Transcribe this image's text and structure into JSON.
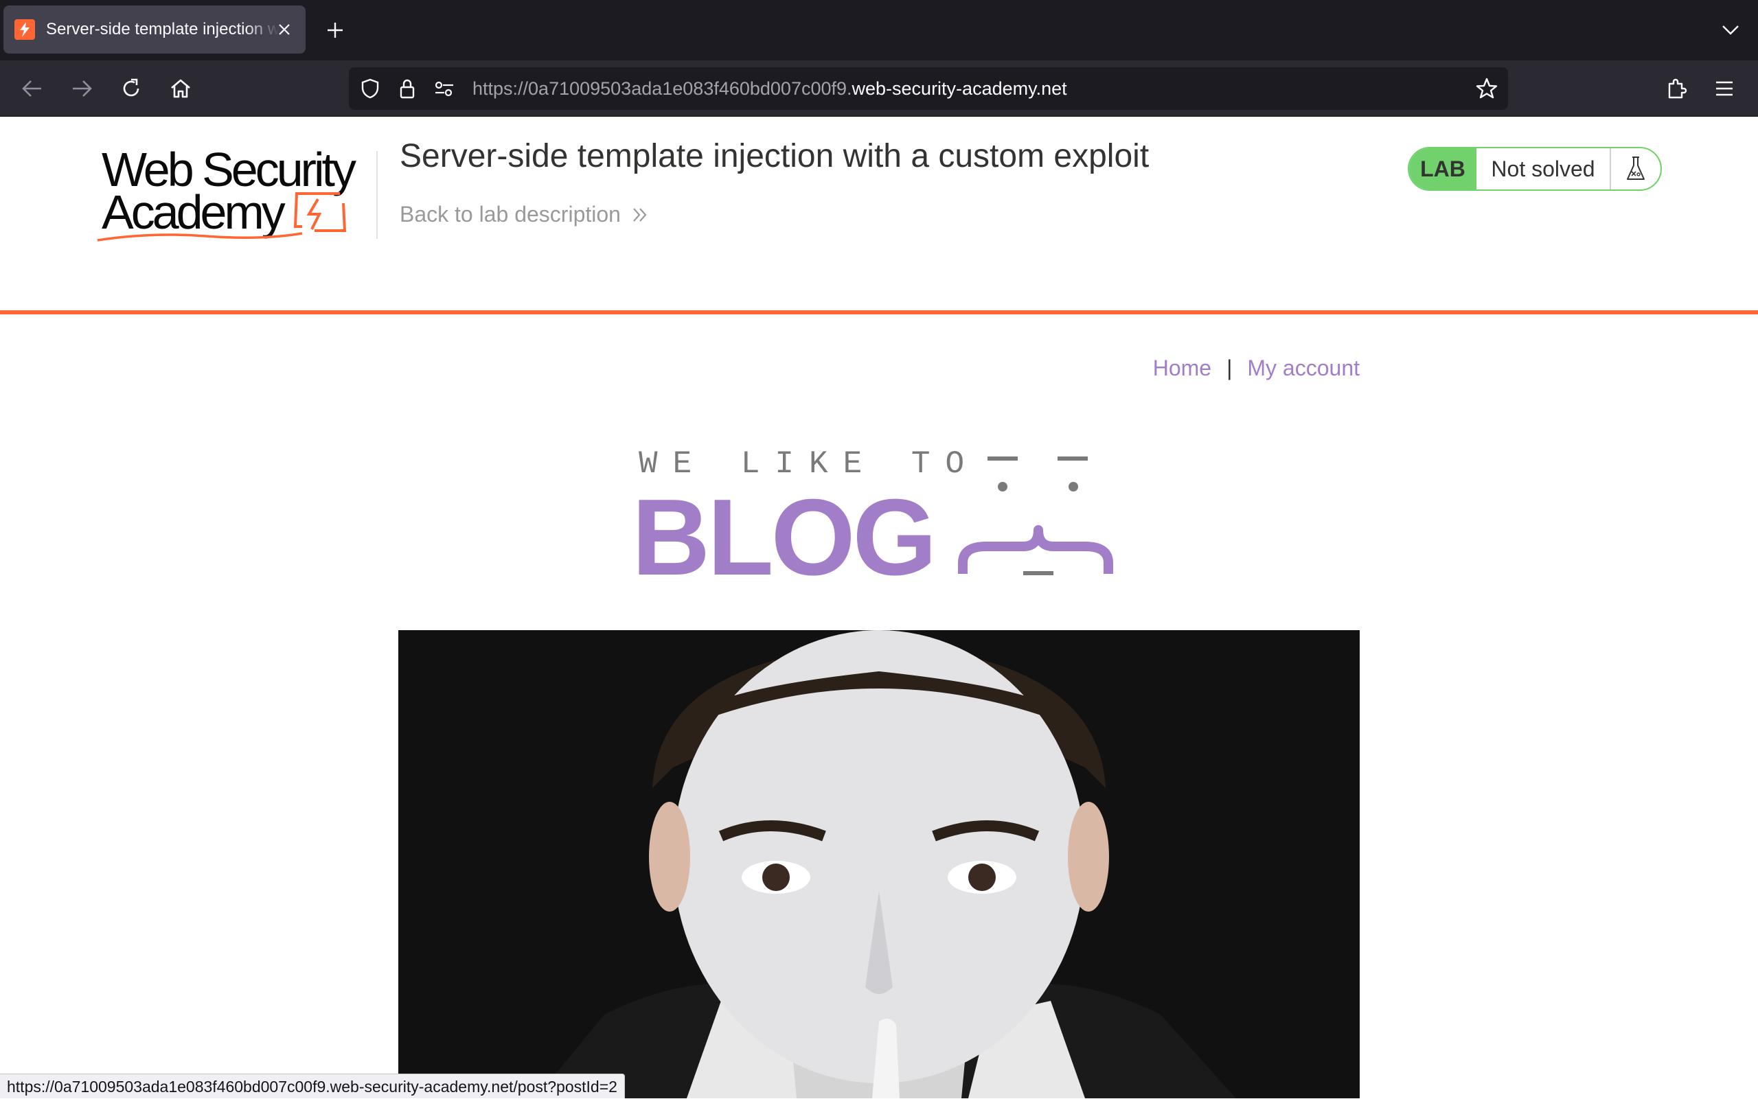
{
  "browser": {
    "tab_title": "Server-side template injection with a custom exploit",
    "url_prefix": "https://0a71009503ada1e083f460bd007c00f9.",
    "url_domain": "web-security-academy.net",
    "status_url": "https://0a71009503ada1e083f460bd007c00f9.web-security-academy.net/post?postId=2"
  },
  "lab": {
    "logo_line1": "Web Security",
    "logo_line2": "Academy",
    "title": "Server-side template injection with a custom exploit",
    "back_link": "Back to lab description",
    "badge": "LAB",
    "status": "Not solved"
  },
  "site": {
    "nav": {
      "home": "Home",
      "separator": "|",
      "account": "My account"
    },
    "banner_small": "WE LIKE TO",
    "banner_big": "BLOG"
  },
  "colors": {
    "accent_orange": "#ff6633",
    "blog_purple": "#a27ec8",
    "lab_green": "#70d16d"
  },
  "icons": [
    "back-icon",
    "forward-icon",
    "reload-icon",
    "home-icon",
    "shield-icon",
    "lock-icon",
    "permissions-icon",
    "bookmark-star-icon",
    "extensions-icon",
    "menu-icon",
    "flask-icon",
    "chevron-right-icon"
  ]
}
